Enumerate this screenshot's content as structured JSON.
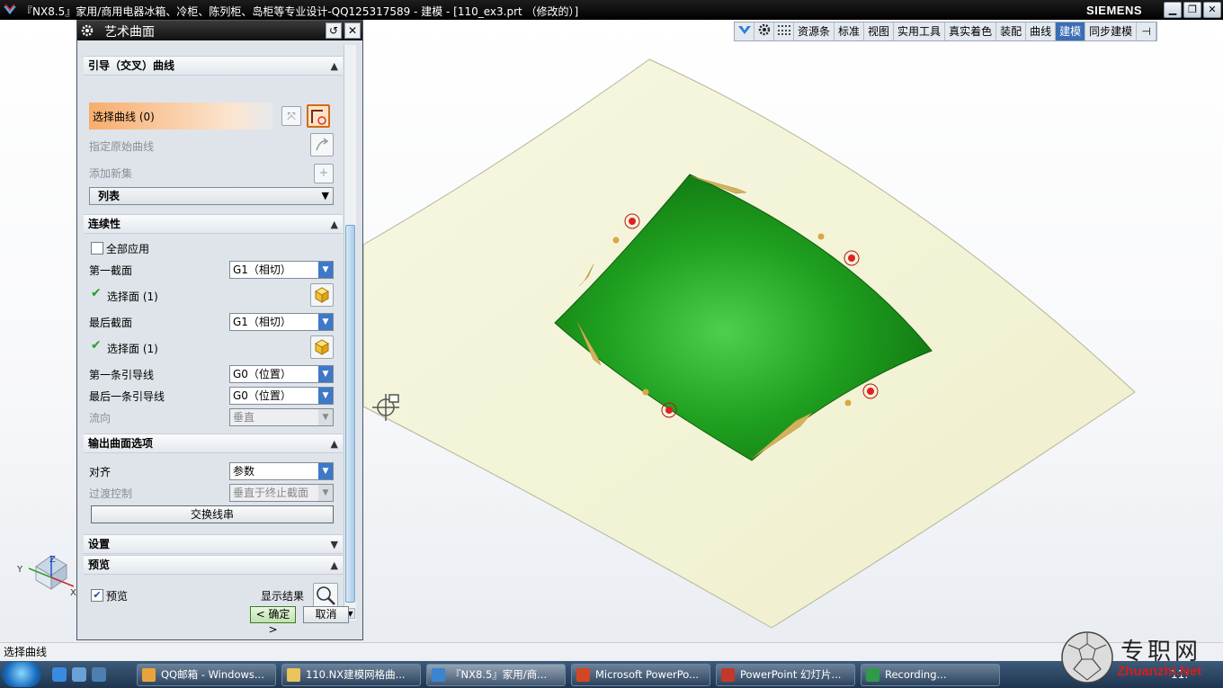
{
  "window": {
    "title": "『NX8.5』家用/商用电器冰箱、冷柜、陈列柜、岛柜等专业设计-QQ125317589 - 建模 - [110_ex3.prt （修改的）]",
    "brand": "SIEMENS",
    "minimize": "▁",
    "maximize": "❐",
    "close": "✕"
  },
  "toolbar": {
    "items": [
      "资源条",
      "标准",
      "视图",
      "实用工具",
      "真实着色",
      "装配",
      "曲线",
      "建模",
      "同步建模"
    ],
    "active": "建模",
    "overflow": "⊣"
  },
  "dialog": {
    "title": "艺术曲面",
    "reset_icon": "↺",
    "close_icon": "✕",
    "guide_section": {
      "header": "引导（交叉）曲线",
      "select_curve": "选择曲线 (0)",
      "specify_origin": "指定原始曲线",
      "add_new_set": "添加新集",
      "list_label": "列表"
    },
    "continuity": {
      "header": "连续性",
      "apply_all": "全部应用",
      "first_section_label": "第一截面",
      "first_section_value": "G1（相切）",
      "select_face_1": "选择面 (1)",
      "last_section_label": "最后截面",
      "last_section_value": "G1（相切）",
      "select_face_2": "选择面 (1)",
      "first_guide_label": "第一条引导线",
      "first_guide_value": "G0（位置）",
      "last_guide_label": "最后一条引导线",
      "last_guide_value": "G0（位置）",
      "flow_label": "流向",
      "flow_value": "垂直"
    },
    "output": {
      "header": "输出曲面选项",
      "align_label": "对齐",
      "align_value": "参数",
      "transition_label": "过渡控制",
      "transition_value": "垂直于终止截面",
      "swap_button": "交换线串"
    },
    "settings_header": "设置",
    "preview": {
      "header": "预览",
      "preview_label": "预览",
      "show_result": "显示结果"
    },
    "ok": "< 确定 >",
    "cancel": "取消"
  },
  "status": {
    "prompt": "选择曲线"
  },
  "axes": {
    "x": "X",
    "y": "Y",
    "z": "Z"
  },
  "taskbar": {
    "tasks": [
      "QQ邮箱 - Windows...",
      "110.NX建模网格曲...",
      "『NX8.5』家用/商...",
      "Microsoft PowerPo...",
      "PowerPoint 幻灯片...",
      "Recording..."
    ],
    "active_index": 2,
    "clock": "11:"
  },
  "watermark": {
    "logo_text": "专职网",
    "url": "Zhuanzhi.Net"
  },
  "colors": {
    "accent_orange": "#f8ad6c",
    "surface_green": "#1a9e1a",
    "sheet_cream": "#f4f4d8",
    "active_tab": "#3c6eb4"
  }
}
